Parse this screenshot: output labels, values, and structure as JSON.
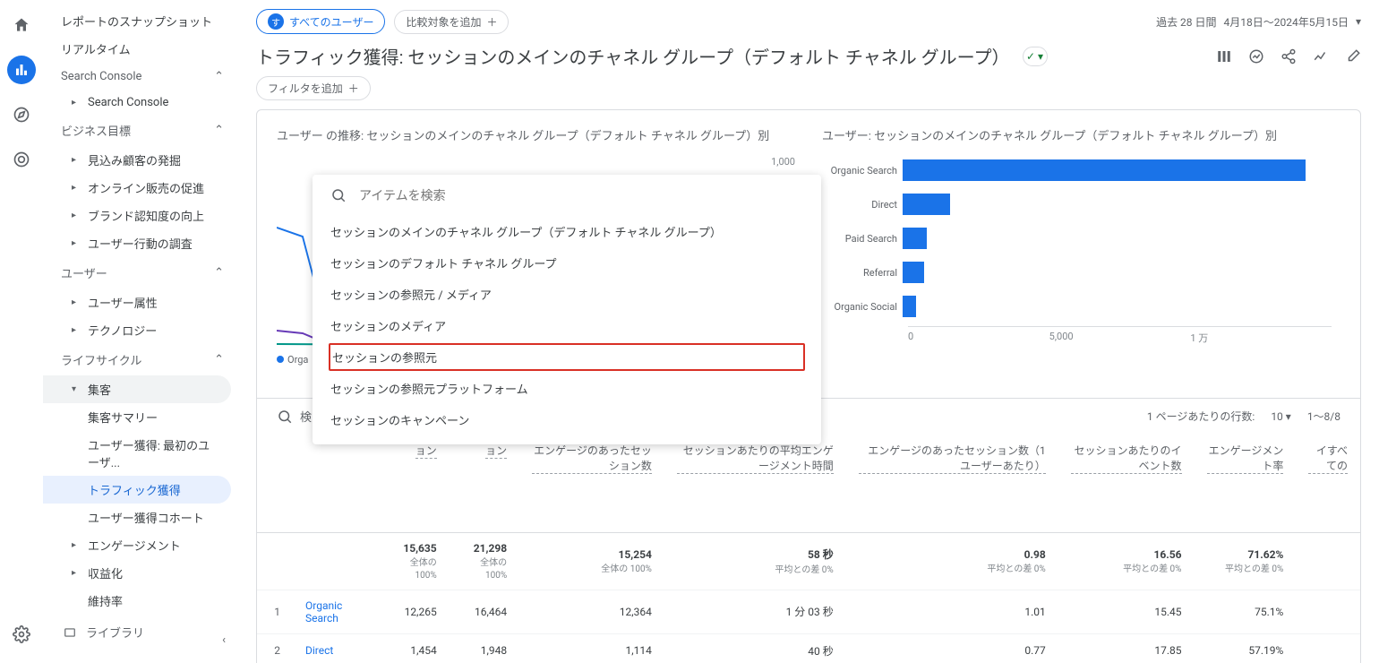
{
  "sidebar": {
    "snapshot": "レポートのスナップショット",
    "realtime": "リアルタイム",
    "sections": {
      "search_console": {
        "label": "Search Console",
        "items": [
          "Search Console"
        ]
      },
      "business": {
        "label": "ビジネス目標",
        "items": [
          "見込み顧客の発掘",
          "オンライン販売の促進",
          "ブランド認知度の向上",
          "ユーザー行動の調査"
        ]
      },
      "user": {
        "label": "ユーザー",
        "items": [
          "ユーザー属性",
          "テクノロジー"
        ]
      },
      "lifecycle": {
        "label": "ライフサイクル",
        "acquisition": "集客",
        "acquisition_items": [
          "集客サマリー",
          "ユーザー獲得: 最初のユーザ...",
          "トラフィック獲得",
          "ユーザー獲得コホート"
        ],
        "engagement": "エンゲージメント",
        "monetization": "収益化",
        "retention": "維持率"
      }
    },
    "library": "ライブラリ"
  },
  "header": {
    "chip_avatar": "す",
    "all_users": "すべてのユーザー",
    "add_compare": "比較対象を追加",
    "date_label": "過去 28 日間",
    "date_range": "4月18日～2024年5月15日",
    "title": "トラフィック獲得: セッションのメインのチャネル グループ（デフォルト チャネル グループ）",
    "add_filter": "フィルタを追加"
  },
  "dropdown": {
    "placeholder": "アイテムを検索",
    "items": [
      "セッションのメインのチャネル グループ（デフォルト チャネル グループ）",
      "セッションのデフォルト チャネル グループ",
      "セッションの参照元 / メディア",
      "セッションのメディア",
      "セッションの参照元",
      "セッションの参照元プラットフォーム",
      "セッションのキャンペーン"
    ],
    "highlighted_index": 4
  },
  "chart_data": [
    {
      "type": "line",
      "title": "ユーザー の推移: セッションのメインのチャネル グループ（デフォルト チャネル グループ）別",
      "ylim": [
        0,
        1000
      ],
      "legend_truncated": "Orga",
      "legend_full": "Organic Search"
    },
    {
      "type": "bar",
      "title": "ユーザー: セッションのメインのチャネル グループ（デフォルト チャネル グループ）別",
      "categories": [
        "Organic Search",
        "Direct",
        "Paid Search",
        "Referral",
        "Organic Social"
      ],
      "values": [
        12200,
        1450,
        720,
        650,
        420
      ],
      "xlim": [
        0,
        13000
      ],
      "ticks": [
        "0",
        "5,000",
        "1 万"
      ]
    }
  ],
  "table": {
    "search_label": "検",
    "rows_per_page_label": "1 ページあたりの行数:",
    "rows_per_page": "10",
    "range": "1～8/8",
    "columns": [
      "エンゲージのあったセッション数",
      "セッションあたりの平均エンゲージメント時間",
      "エンゲージのあったセッション数（1 ユーザーあたり）",
      "セッションあたりのイベント数",
      "エンゲージメント率",
      "イすべての"
    ],
    "hidden_cols_stub": [
      "",
      ""
    ],
    "totals": {
      "number_idx": "",
      "values": [
        "15,635",
        "21,298",
        "15,254",
        "58 秒",
        "0.98",
        "16.56",
        "71.62%"
      ],
      "subs": [
        "全体の 100%",
        "全体の 100%",
        "全体の 100%",
        "平均との差 0%",
        "平均との差 0%",
        "平均との差 0%",
        "平均との差 0%"
      ]
    },
    "rows": [
      {
        "idx": "1",
        "name": "Organic Search",
        "values": [
          "12,265",
          "16,464",
          "12,364",
          "1 分 03 秒",
          "1.01",
          "15.45",
          "75.1%"
        ]
      },
      {
        "idx": "2",
        "name": "Direct",
        "values": [
          "1,454",
          "1,948",
          "1,114",
          "40 秒",
          "0.77",
          "17.85",
          "57.19%"
        ]
      }
    ]
  }
}
